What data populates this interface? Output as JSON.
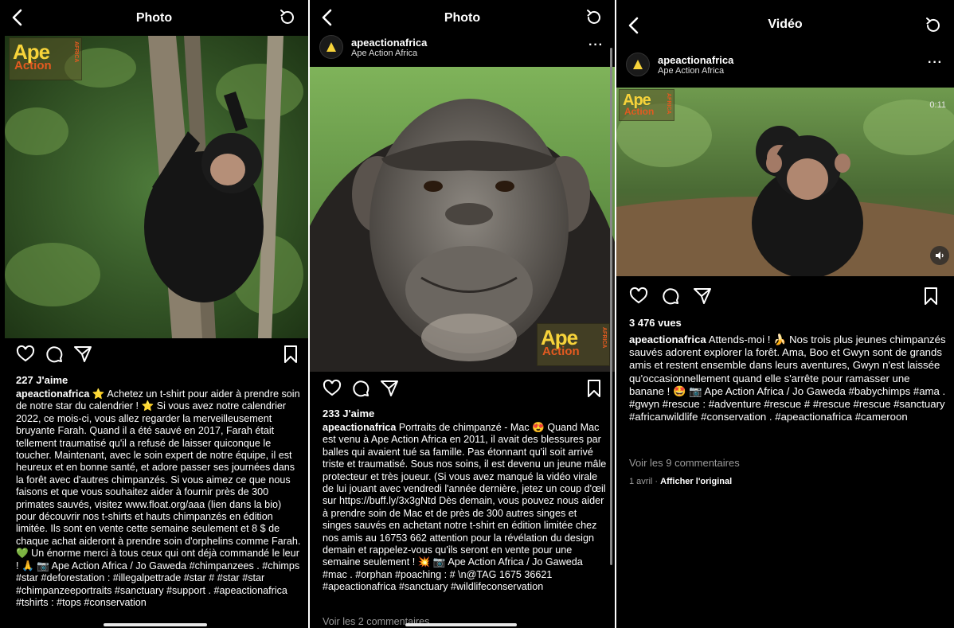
{
  "panel1": {
    "title": "Photo",
    "likes": "227 J'aime",
    "username": "apeactionafrica",
    "caption": "⭐ Achetez un t-shirt pour aider à prendre soin de notre star du calendrier ! ⭐ Si vous avez notre calendrier 2022, ce mois-ci, vous allez regarder la merveilleusement bruyante Farah. Quand il a été sauvé en 2017, Farah était tellement traumatisé qu'il a refusé de laisser quiconque le toucher. Maintenant, avec le soin expert de notre équipe, il est heureux et en bonne santé, et adore passer ses journées dans la forêt avec d'autres chimpanzés. Si vous aimez ce que nous faisons et que vous souhaitez aider à fournir près de 300 primates sauvés, visitez www.float.org/aaa (lien dans la bio) pour découvrir nos t-shirts et hauts chimpanzés en édition limitée. Ils sont en vente cette semaine seulement et 8 $ de chaque achat aideront à prendre soin d'orphelins comme Farah. 💚 Un énorme merci à tous ceux qui ont déjà commandé le leur ! 🙏 📷 Ape Action Africa / Jo Gaweda  #chimpanzees . #chimps #star #deforestation : #illegalpettrade #star # #star #star #chimpanzeeportraits #sanctuary #support . #apeactionafrica #tshirts : #tops #conservation"
  },
  "panel2": {
    "title": "Photo",
    "username": "apeactionafrica",
    "account_sub": "Ape Action Africa",
    "likes": "233 J'aime",
    "caption": "Portraits de chimpanzé - Mac 😍 Quand Mac est venu à Ape Action Africa en 2011, il avait des blessures par balles qui avaient tué sa famille. Pas étonnant qu'il soit arrivé triste et traumatisé. Sous nos soins, il est devenu un jeune mâle protecteur et très joueur. (Si vous avez manqué la vidéo virale de lui jouant avec vendredi l'année dernière, jetez un coup d'œil sur https://buff.ly/3x3gNtd Dès demain, vous pouvez nous aider à prendre soin de Mac et de près de 300 autres singes et singes sauvés en achetant notre t-shirt en édition limitée chez nos amis au 16753 662 attention pour la révélation du design demain et rappelez-vous qu'ils seront en vente pour une semaine seulement ! 💥 📷 Ape Action Africa / Jo Gaweda  #mac . #orphan #poaching :  #  \\n@TAG 1675 36621 #apeactionafrica #sanctuary #wildlifeconservation",
    "comments_link": "Voir les 2 commentaires"
  },
  "panel3": {
    "title": "Vidéo",
    "username": "apeactionafrica",
    "account_sub": "Ape Action Africa",
    "timer": "0:11",
    "views": "3 476 vues",
    "caption": "Attends-moi ! 🍌 Nos trois plus jeunes chimpanzés sauvés adorent explorer la forêt. Ama, Boo et Gwyn sont de grands amis et restent ensemble dans leurs aventures, Gwyn n'est laissée qu'occasionnellement quand elle s'arrête pour ramasser une banane ! 🤩 📷 Ape Action Africa / Jo Gaweda  #babychimps #ama . #gwyn #rescue : #adventure #rescue # #rescue #rescue #sanctuary #africanwildlife #conservation . #apeactionafrica #cameroon",
    "comments_link": "Voir les 9 commentaires",
    "date": "1 avril",
    "separator": "·",
    "translate": "Afficher l'original"
  },
  "logo": {
    "ape": "Ape",
    "action": "Action",
    "africa": "AFRICA"
  },
  "colors": {
    "background": "#000000",
    "text": "#ffffff",
    "muted": "#9a9a9a",
    "logo_yellow": "#f7d33a",
    "logo_orange": "#e45a20"
  },
  "icons": [
    "back-icon",
    "refresh-icon",
    "heart-icon",
    "comment-icon",
    "share-icon",
    "bookmark-icon",
    "more-icon",
    "mute-icon"
  ]
}
